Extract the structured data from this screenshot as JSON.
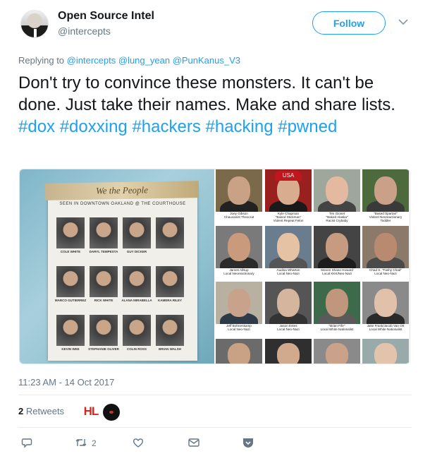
{
  "header": {
    "name": "Open Source Intel",
    "handle": "@intercepts",
    "follow_label": "Follow"
  },
  "reply": {
    "prefix": "Replying to",
    "mentions": [
      "@intercepts",
      "@lung_yean",
      "@PunKanus_V3"
    ]
  },
  "tweet": {
    "text": "Don't try to convince these monsters. It can't be done. Just take their names. Make and share lists.",
    "hashtags": "#dox #doxxing #hackers #hacking #pwned"
  },
  "media": {
    "poster": {
      "banner": "We the People",
      "subtitle": "SEEN IN DOWNTOWN OAKLAND @ THE COURTHOUSE",
      "names": [
        "COLE WHITE",
        "DARYL TEMPESTA",
        "GUY DICKER",
        "",
        "MARCO GUTIERREZ",
        "RICK WHITE",
        "ALANA MIRABELLA",
        "KAMERA RILEY",
        "KEVIN WEE",
        "STEPHANIE OLIVER",
        "COLIN ROSS",
        "BRIAN WALSH"
      ]
    },
    "grid_captions": [
      [
        "Joey Gibson",
        "Chauvanist Theocrat"
      ],
      [
        "Kyle Chapman",
        "\"Based Stickman\"",
        "Violent Repeat Felon"
      ],
      [
        "Tim Gionet",
        "\"Baked Alaska\"",
        "Racist Crybaby"
      ],
      [
        "\"Based Spartan\"",
        "Violent Neoreactionary",
        "Toddler"
      ],
      [
        "James Allsup",
        "Local Neoreactionary"
      ],
      [
        "Audina Wharton",
        "Local Neo-Nazi"
      ],
      [
        "Steven Shane Howard",
        "Local KKK/Neo-Nazi"
      ],
      [
        "Chad S. \"Fashy Chad\"",
        "Local Neo-Nazi"
      ],
      [
        "Jeff Bohnenkamp",
        "Local Neo-Nazi"
      ],
      [
        "Jason Estes",
        "Local Neo-Nazi"
      ],
      [
        "\"Brian Fife\"",
        "Local White Nationalist"
      ],
      [
        "Jake Frank/Jacob Van Ott",
        "Local White Nationalist"
      ]
    ],
    "hat_text": "USA"
  },
  "timestamp": "11:23 AM - 14 Oct 2017",
  "stats": {
    "retweet_count": "2",
    "retweet_label": "Retweets",
    "badge": "HL"
  },
  "actions": {
    "retweet_count": "2"
  },
  "colors": {
    "accent": "#1da1f2",
    "muted": "#657786",
    "divider": "#e6ecf0"
  }
}
